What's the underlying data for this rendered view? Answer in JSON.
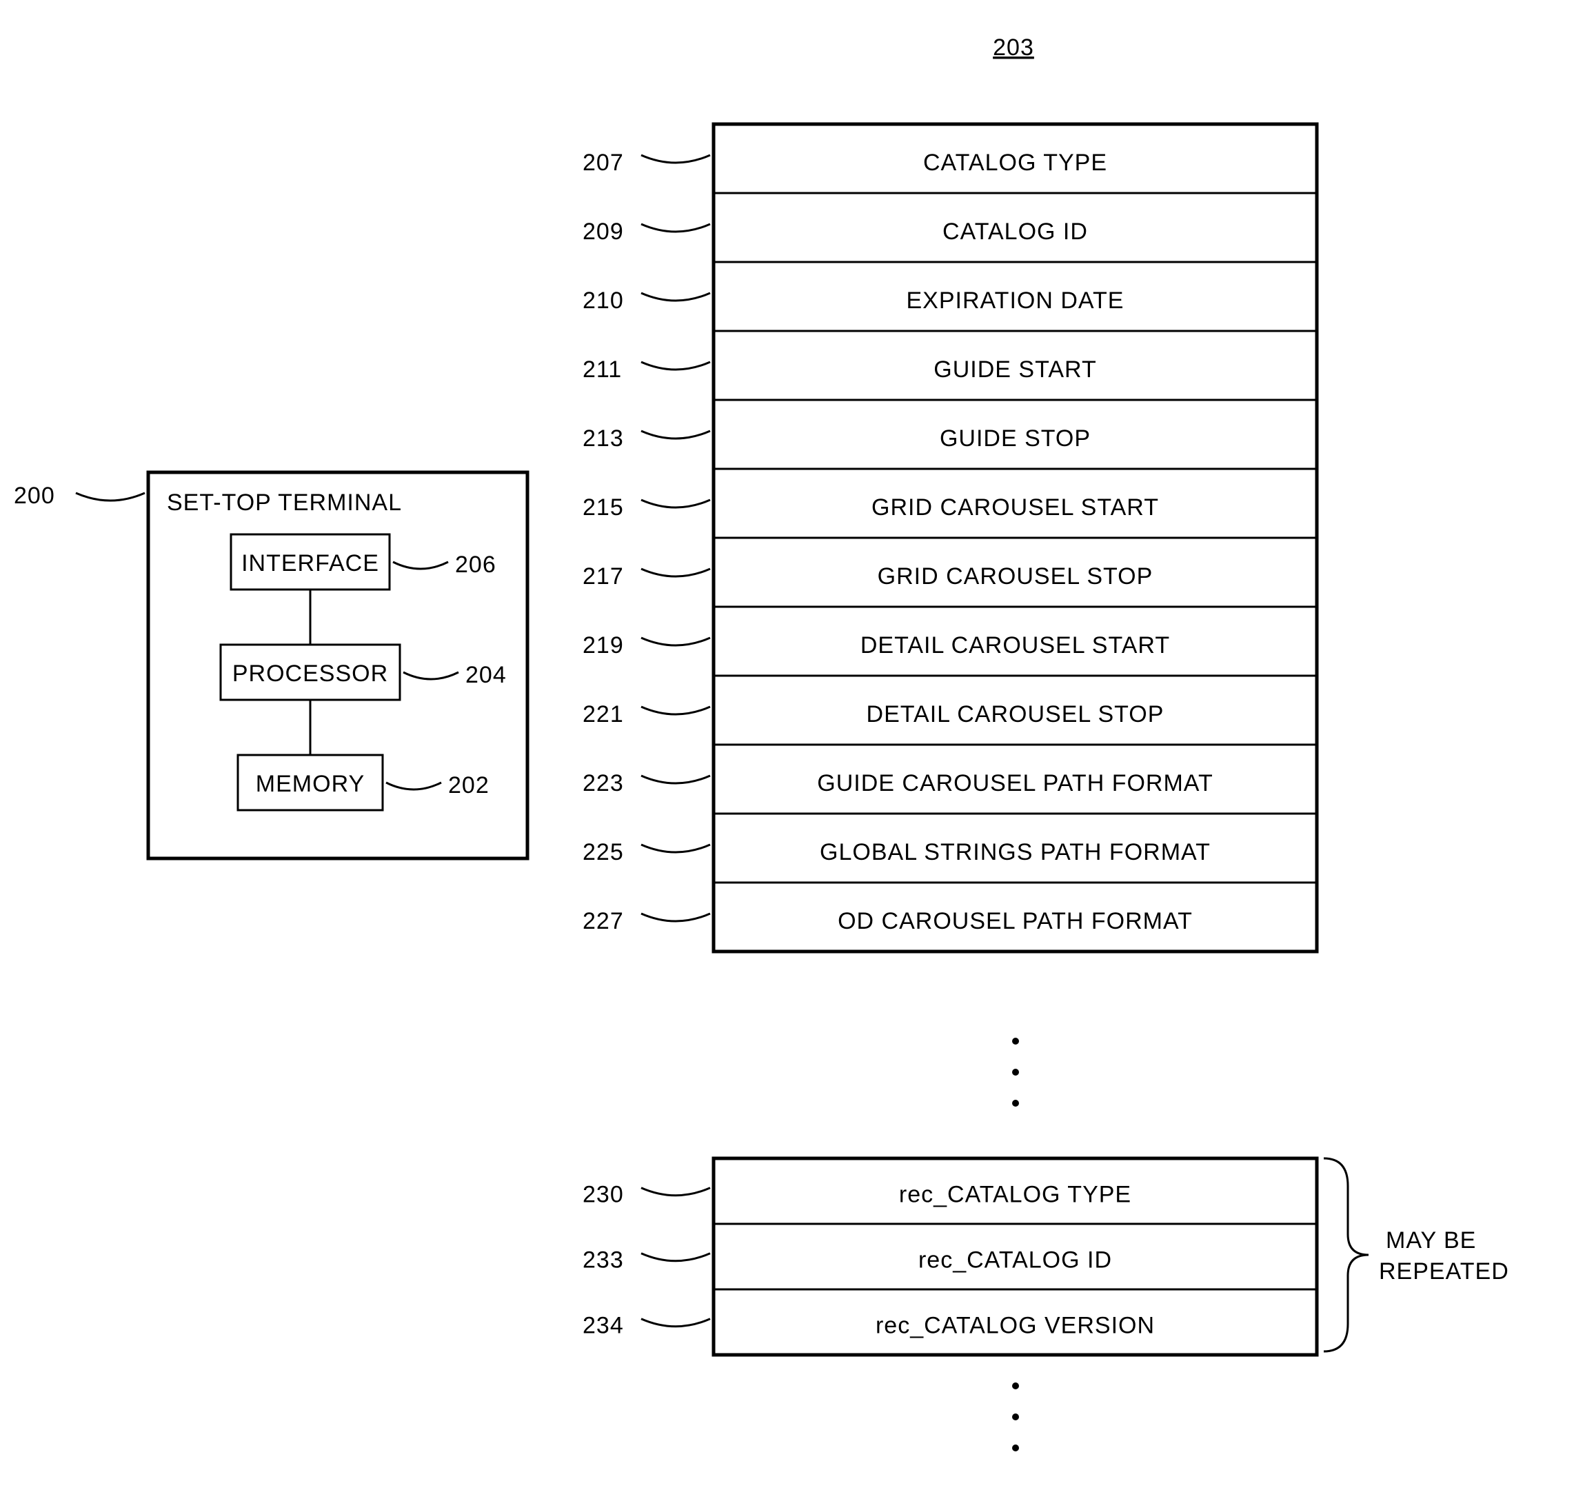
{
  "title_ref": "203",
  "terminal": {
    "ref": "200",
    "label": "SET-TOP TERMINAL",
    "blocks": [
      {
        "ref": "206",
        "label": "INTERFACE"
      },
      {
        "ref": "204",
        "label": "PROCESSOR"
      },
      {
        "ref": "202",
        "label": "MEMORY"
      }
    ]
  },
  "fields1": [
    {
      "ref": "207",
      "label": "CATALOG TYPE"
    },
    {
      "ref": "209",
      "label": "CATALOG ID"
    },
    {
      "ref": "210",
      "label": "EXPIRATION DATE"
    },
    {
      "ref": "211",
      "label": "GUIDE START"
    },
    {
      "ref": "213",
      "label": "GUIDE STOP"
    },
    {
      "ref": "215",
      "label": "GRID CAROUSEL START"
    },
    {
      "ref": "217",
      "label": "GRID CAROUSEL STOP"
    },
    {
      "ref": "219",
      "label": "DETAIL CAROUSEL START"
    },
    {
      "ref": "221",
      "label": "DETAIL CAROUSEL STOP"
    },
    {
      "ref": "223",
      "label": "GUIDE CAROUSEL PATH FORMAT"
    },
    {
      "ref": "225",
      "label": "GLOBAL STRINGS PATH FORMAT"
    },
    {
      "ref": "227",
      "label": "OD CAROUSEL PATH FORMAT"
    }
  ],
  "fields2": [
    {
      "ref": "230",
      "label": "rec_CATALOG TYPE"
    },
    {
      "ref": "233",
      "label": "rec_CATALOG ID"
    },
    {
      "ref": "234",
      "label": "rec_CATALOG VERSION"
    }
  ],
  "note": {
    "l1": "MAY BE",
    "l2": "REPEATED"
  }
}
